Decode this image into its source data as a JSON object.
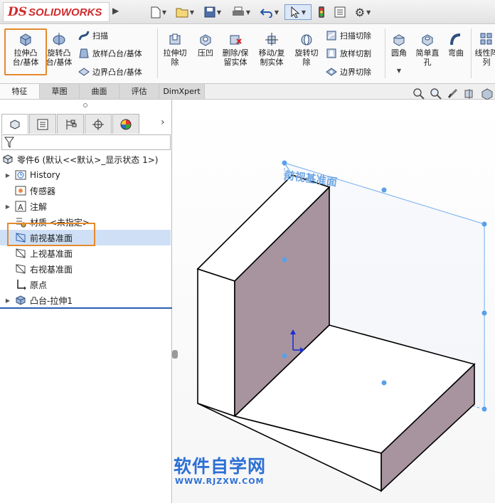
{
  "app": {
    "brand_mark": "DS",
    "brand_name": "SOLIDWORKS"
  },
  "quick_access": {
    "icons": [
      "new-document-icon",
      "open-folder-icon",
      "save-icon",
      "print-icon",
      "undo-icon",
      "select-cursor-icon",
      "traffic-light-icon",
      "file-properties-icon",
      "options-gear-icon"
    ]
  },
  "ribbon": {
    "extrude_boss": "拉伸凸\n台/基体",
    "revolve_boss": "旋转凸\n台/基体",
    "sweep": "扫描",
    "loft_boss": "放样凸台/基体",
    "boundary_boss": "边界凸台/基体",
    "extrude_cut": "拉伸切\n除",
    "hole_wizard": "压凹",
    "delete_keep_body": "删除/保\n留实体",
    "move_copy_body": "移动/复\n制实体",
    "revolve_cut": "旋转切\n除",
    "sweep_cut": "扫描切除",
    "loft_cut": "放样切割",
    "boundary_cut": "边界切除",
    "fillet": "圆角",
    "simple_hole": "简单直\n孔",
    "flex": "弯曲",
    "linear_pattern": "线性阵\n列"
  },
  "tabs": [
    {
      "label": "特征"
    },
    {
      "label": "草图"
    },
    {
      "label": "曲面"
    },
    {
      "label": "评估"
    },
    {
      "label": "DimXpert"
    }
  ],
  "tree": {
    "root": "零件6  (默认<<默认>_显示状态 1>)",
    "items": [
      {
        "label": "History",
        "icon": "history-icon"
      },
      {
        "label": "传感器",
        "icon": "sensor-icon"
      },
      {
        "label": "注解",
        "icon": "annotation-icon"
      },
      {
        "label": "材质 <未指定>",
        "icon": "material-icon"
      },
      {
        "label": "前视基准面",
        "icon": "plane-icon"
      },
      {
        "label": "上视基准面",
        "icon": "plane-icon"
      },
      {
        "label": "右视基准面",
        "icon": "plane-icon"
      },
      {
        "label": "原点",
        "icon": "origin-icon"
      },
      {
        "label": "凸台-拉伸1",
        "icon": "boss-extrude-icon"
      }
    ]
  },
  "viewport": {
    "plane_label": "前视基准面",
    "model_colors": {
      "face_light": "#ffffff",
      "face_shade": "#a8949e",
      "plane_edge": "#5aa0e8",
      "edge": "#000000"
    }
  },
  "watermark": {
    "title": "软件自学网",
    "url": "WWW.RJZXW.COM"
  }
}
